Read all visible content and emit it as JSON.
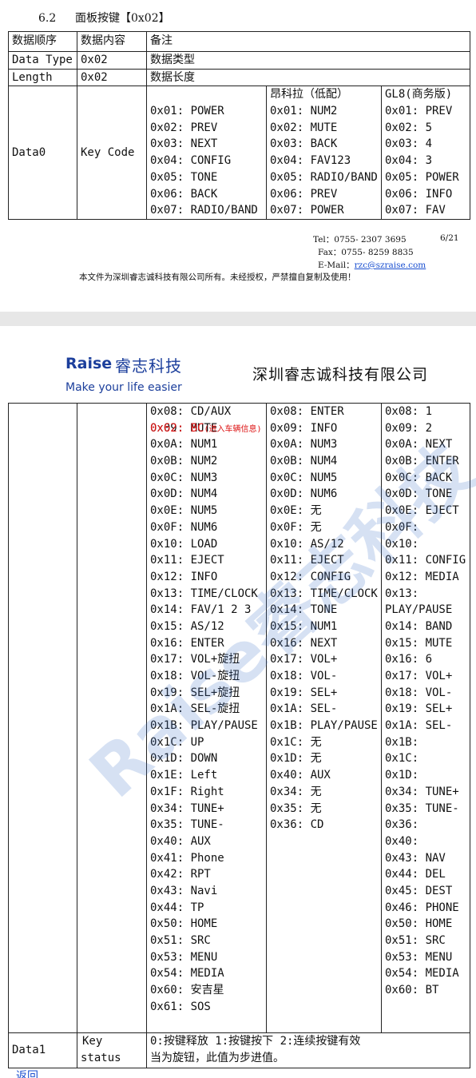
{
  "section": {
    "number": "6.2",
    "title": "面板按键【0x02】"
  },
  "table_head": {
    "c1": "数据顺序",
    "c2": "数据内容",
    "c3": "备注"
  },
  "row_type": {
    "name": "Data Type",
    "value": "0x02",
    "note": "数据类型"
  },
  "row_length": {
    "name": "Length",
    "value": "0x02",
    "note": "数据长度"
  },
  "row_data0": {
    "name": "Data0",
    "value": "Key Code",
    "col_a_header": "",
    "col_b_header": "昂科拉（低配）",
    "col_c_header": "GL8(商务版)",
    "col_a": [
      "0x01: POWER",
      "0x02: PREV",
      "0x03: NEXT",
      "0x04: CONFIG",
      "0x05: TONE",
      "0x06: BACK",
      "0x07: RADIO/BAND"
    ],
    "col_b": [
      "0x01: NUM2",
      "0x02: MUTE",
      "0x03: BACK",
      "0x04: FAV123",
      "0x05: RADIO/BAND",
      "0x06: PREV",
      "0x07: POWER"
    ],
    "col_c": [
      "0x01: PREV",
      "0x02: 5",
      "0x03: 4",
      "0x04: 3",
      "0x05: POWER",
      "0x06: INFO",
      "0x07: FAV"
    ]
  },
  "footer": {
    "tel": "Tel：0755- 2307 3695",
    "page": "6/21",
    "fax": "Fax：0755- 8259 8835",
    "email_label": "E-Mail：",
    "email": "rzc@szraise.com",
    "copyright": "本文件为深圳睿志诚科技有限公司所有。未经授权，严禁擅自复制及使用！"
  },
  "header": {
    "logo_en": "Raise",
    "logo_cn": "睿志科技",
    "slogan": "Make your life easier",
    "company": "深圳睿志诚科技有限公司"
  },
  "watermark": "Raise睿志科技",
  "cont": {
    "col_a": [
      "0x08: CD/AUX",
      "0x09: MUTE",
      "0x0A: NUM1",
      "0x0B: NUM2",
      "0x0C: NUM3",
      "0x0D: NUM4",
      "0x0E: NUM5",
      "0x0F: NUM6",
      "0x10: LOAD",
      "0x11: EJECT",
      "0x12: INFO",
      "0x13: TIME/CLOCK",
      "0x14: FAV/1 2 3",
      "0x15: AS/12",
      "0x16: ENTER",
      "0x17: VOL+旋扭",
      "0x18: VOL-旋扭",
      "0x19: SEL+旋扭",
      "0x1A: SEL-旋扭",
      "0x1B: PLAY/PAUSE",
      "0x1C: UP",
      "0x1D: DOWN",
      "0x1E: Left",
      "0x1F: Right",
      "0x34: TUNE+",
      "0x35: TUNE-",
      "0x40: AUX",
      "0x41: Phone",
      "0x42: RPT",
      "0x43: Navi",
      "0x44: TP",
      "0x50: HOME",
      "0x51: SRC",
      "0x53: MENU",
      "0x54: MEDIA",
      "0x60: 安吉星",
      "0x61: SOS"
    ],
    "col_a_red": "0x62: BC",
    "col_a_red_note": "(进入车辆信息)",
    "col_b": [
      "0x08: ENTER",
      "0x09: INFO",
      "0x0A: NUM3",
      "0x0B: NUM4",
      "0x0C: NUM5",
      "0x0D: NUM6",
      "0x0E: 无",
      "0x0F: 无",
      "0x10: AS/12",
      "0x11: EJECT",
      "0x12: CONFIG",
      "0x13: TIME/CLOCK",
      "0x14: TONE",
      "0x15: NUM1",
      "0x16: NEXT",
      "0x17: VOL+",
      "0x18: VOL-",
      "0x19: SEL+",
      "0x1A: SEL-",
      "0x1B: PLAY/PAUSE",
      "0x1C: 无",
      "0x1D: 无",
      "0x40: AUX",
      "0x34: 无",
      "0x35: 无",
      "0x36: CD"
    ],
    "col_c": [
      "0x08: 1",
      "0x09: 2",
      "0x0A: NEXT",
      "0x0B: ENTER",
      "0x0C: BACK",
      "0x0D: TONE",
      "0x0E: EJECT",
      "0x0F:",
      "0x10:",
      "0x11: CONFIG",
      "0x12: MEDIA",
      "0x13:",
      "PLAY/PAUSE",
      "0x14: BAND",
      "0x15: MUTE",
      "0x16: 6",
      "0x17: VOL+",
      "0x18: VOL-",
      "0x19: SEL+",
      "0x1A: SEL-",
      "0x1B:",
      "0x1C:",
      "0x1D:",
      "0x34: TUNE+",
      "0x35: TUNE-",
      "0x36:",
      "0x40:",
      "0x43: NAV",
      "0x44: DEL",
      "0x45: DEST",
      "0x46: PHONE",
      "0x50: HOME",
      "0x51: SRC",
      "0x53: MENU",
      "0x54: MEDIA",
      "0x60: BT"
    ]
  },
  "row_data1": {
    "name": "Data1",
    "value_line1": "Key",
    "value_line2": "status",
    "note_line1": "0:按键释放   1:按键按下   2:连续按键有效",
    "note_line2": "当为旋钮，此值为步进值。"
  },
  "back_link": "返回"
}
